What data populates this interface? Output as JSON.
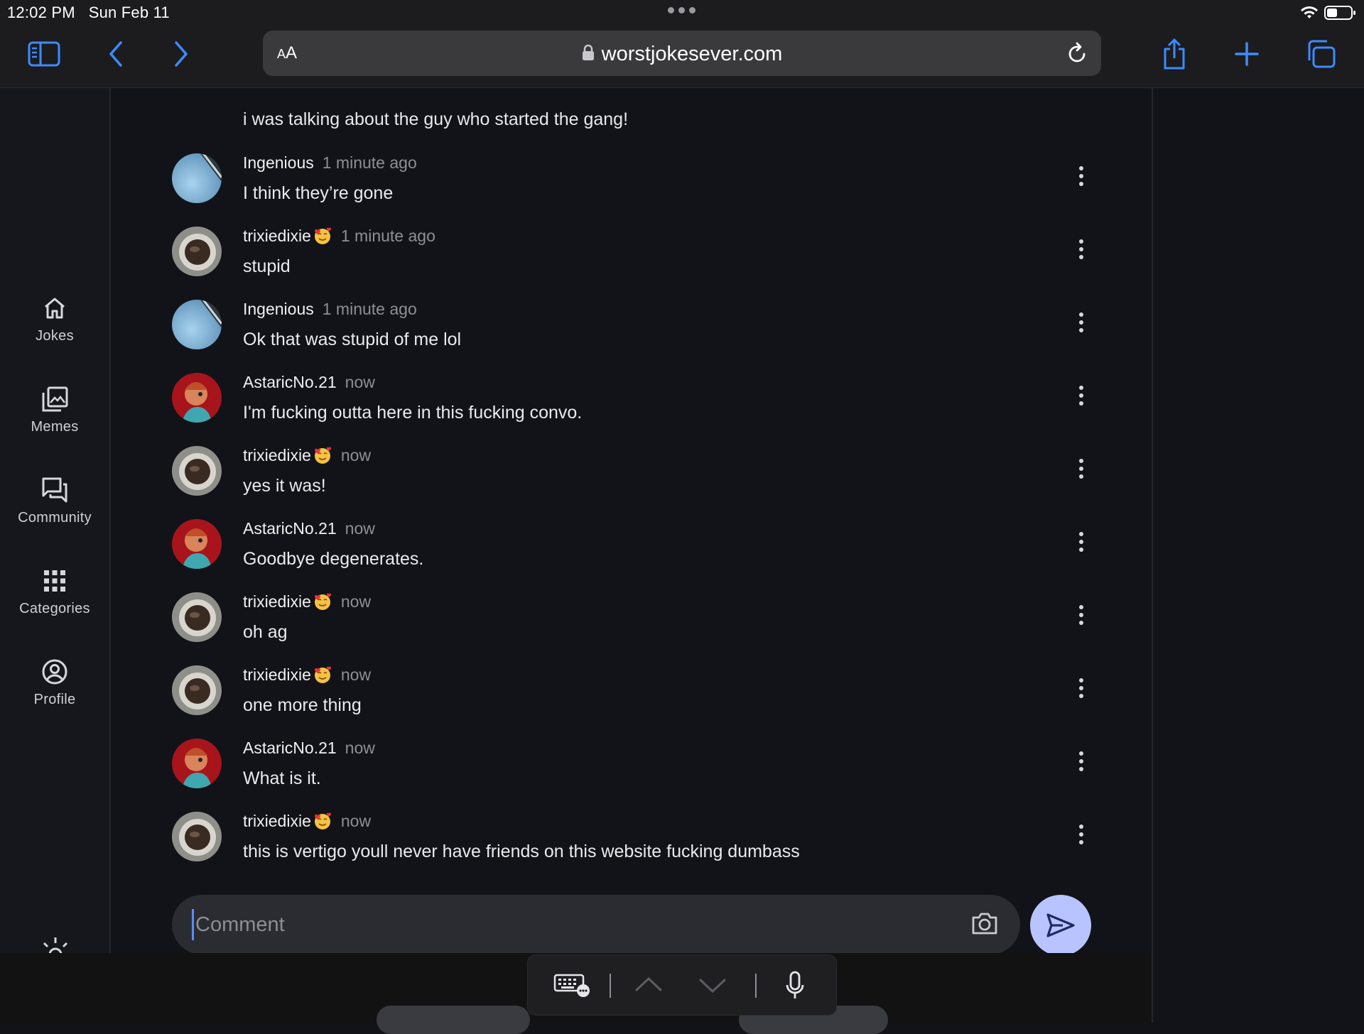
{
  "status_bar": {
    "time": "12:02 PM",
    "date": "Sun Feb 11"
  },
  "browser": {
    "text_size_label_small": "A",
    "text_size_label_large": "A",
    "url": "worstjokesever.com",
    "icons": [
      "sidebar-icon",
      "back-icon",
      "forward-icon",
      "lock-icon",
      "reload-icon",
      "share-icon",
      "new-tab-icon",
      "tabs-icon"
    ]
  },
  "sidebar": {
    "items": [
      {
        "label": "Jokes",
        "icon": "home-icon"
      },
      {
        "label": "Memes",
        "icon": "gallery-icon"
      },
      {
        "label": "Community",
        "icon": "forum-icon"
      },
      {
        "label": "Categories",
        "icon": "grid-icon"
      },
      {
        "label": "Profile",
        "icon": "account-icon"
      }
    ]
  },
  "comments": {
    "previous_text": "i was talking about the guy who started the gang!",
    "items": [
      {
        "user": "Ingenious",
        "emoji": "",
        "time": "1 minute ago",
        "text": "I think they’re gone"
      },
      {
        "user": "trixiedixie",
        "emoji": "🥰",
        "time": "1 minute ago",
        "text": "stupid"
      },
      {
        "user": "Ingenious",
        "emoji": "",
        "time": "1 minute ago",
        "text": "Ok that was stupid of me lol"
      },
      {
        "user": "AstaricNo.21",
        "emoji": "",
        "time": "now",
        "text": "I'm fucking outta here in this fucking convo."
      },
      {
        "user": "trixiedixie",
        "emoji": "🥰",
        "time": "now",
        "text": "yes it was!"
      },
      {
        "user": "AstaricNo.21",
        "emoji": "",
        "time": "now",
        "text": "Goodbye degenerates."
      },
      {
        "user": "trixiedixie",
        "emoji": "🥰",
        "time": "now",
        "text": "oh ag"
      },
      {
        "user": "trixiedixie",
        "emoji": "🥰",
        "time": "now",
        "text": "one more thing"
      },
      {
        "user": "AstaricNo.21",
        "emoji": "",
        "time": "now",
        "text": "What is it."
      },
      {
        "user": "trixiedixie",
        "emoji": "🥰",
        "time": "now",
        "text": "this is vertigo youll never have friends on this website fucking dumbass"
      }
    ]
  },
  "composer": {
    "placeholder": "Comment",
    "value": ""
  },
  "colors": {
    "accent": "#b8c4ff",
    "link_blue": "#3d8bff",
    "background": "#121318"
  }
}
